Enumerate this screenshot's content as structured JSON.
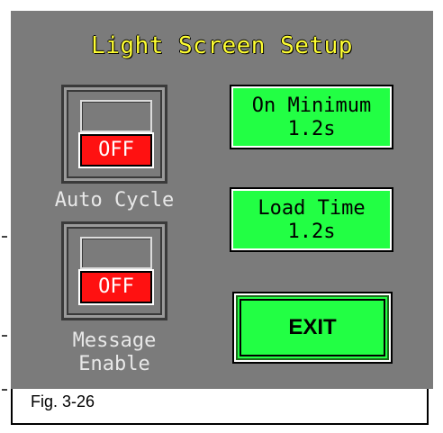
{
  "screen": {
    "title": "Light Screen Setup",
    "accent_title_color": "#ffff33",
    "panel_color": "#7b7b7b"
  },
  "toggles": [
    {
      "label": "Auto Cycle",
      "state": "OFF"
    },
    {
      "label_line1": "Message",
      "label_line2": "Enable",
      "state": "OFF"
    }
  ],
  "buttons": {
    "on_minimum": {
      "line1": "On Minimum",
      "line2": "1.2s"
    },
    "load_time": {
      "line1": "Load Time",
      "line2": "1.2s"
    },
    "exit": "EXIT"
  },
  "caption": "Fig. 3-26"
}
